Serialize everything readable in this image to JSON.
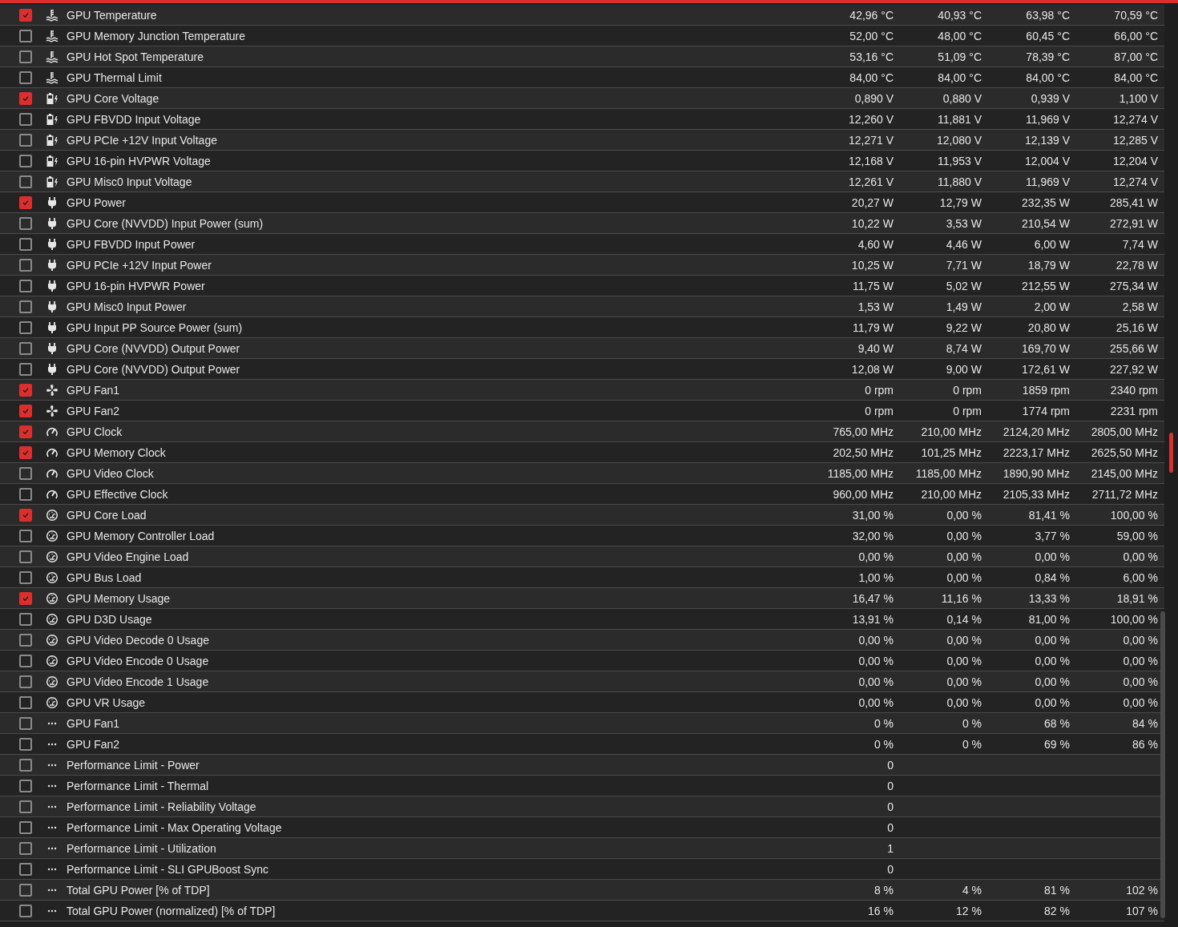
{
  "rows": [
    {
      "kind": "temperature",
      "checked": true,
      "name": "GPU Temperature",
      "values": [
        "42,96 °C",
        "40,93 °C",
        "63,98 °C",
        "70,59 °C"
      ]
    },
    {
      "kind": "temperature",
      "checked": false,
      "name": "GPU Memory Junction Temperature",
      "values": [
        "52,00 °C",
        "48,00 °C",
        "60,45 °C",
        "66,00 °C"
      ]
    },
    {
      "kind": "temperature",
      "checked": false,
      "name": "GPU Hot Spot Temperature",
      "values": [
        "53,16 °C",
        "51,09 °C",
        "78,39 °C",
        "87,00 °C"
      ]
    },
    {
      "kind": "temperature",
      "checked": false,
      "name": "GPU Thermal Limit",
      "values": [
        "84,00 °C",
        "84,00 °C",
        "84,00 °C",
        "84,00 °C"
      ]
    },
    {
      "kind": "voltage",
      "checked": true,
      "name": "GPU Core Voltage",
      "values": [
        "0,890 V",
        "0,880 V",
        "0,939 V",
        "1,100 V"
      ]
    },
    {
      "kind": "voltage",
      "checked": false,
      "name": "GPU FBVDD Input Voltage",
      "values": [
        "12,260 V",
        "11,881 V",
        "11,969 V",
        "12,274 V"
      ]
    },
    {
      "kind": "voltage",
      "checked": false,
      "name": "GPU PCIe +12V Input Voltage",
      "values": [
        "12,271 V",
        "12,080 V",
        "12,139 V",
        "12,285 V"
      ]
    },
    {
      "kind": "voltage",
      "checked": false,
      "name": "GPU 16-pin HVPWR Voltage",
      "values": [
        "12,168 V",
        "11,953 V",
        "12,004 V",
        "12,204 V"
      ]
    },
    {
      "kind": "voltage",
      "checked": false,
      "name": "GPU Misc0 Input Voltage",
      "values": [
        "12,261 V",
        "11,880 V",
        "11,969 V",
        "12,274 V"
      ]
    },
    {
      "kind": "power",
      "checked": true,
      "name": "GPU Power",
      "values": [
        "20,27 W",
        "12,79 W",
        "232,35 W",
        "285,41 W"
      ]
    },
    {
      "kind": "power",
      "checked": false,
      "name": "GPU Core (NVVDD) Input Power (sum)",
      "values": [
        "10,22 W",
        "3,53 W",
        "210,54 W",
        "272,91 W"
      ]
    },
    {
      "kind": "power",
      "checked": false,
      "name": "GPU FBVDD Input Power",
      "values": [
        "4,60 W",
        "4,46 W",
        "6,00 W",
        "7,74 W"
      ]
    },
    {
      "kind": "power",
      "checked": false,
      "name": "GPU PCIe +12V Input Power",
      "values": [
        "10,25 W",
        "7,71 W",
        "18,79 W",
        "22,78 W"
      ]
    },
    {
      "kind": "power",
      "checked": false,
      "name": "GPU 16-pin HVPWR Power",
      "values": [
        "11,75 W",
        "5,02 W",
        "212,55 W",
        "275,34 W"
      ]
    },
    {
      "kind": "power",
      "checked": false,
      "name": "GPU Misc0 Input Power",
      "values": [
        "1,53 W",
        "1,49 W",
        "2,00 W",
        "2,58 W"
      ]
    },
    {
      "kind": "power",
      "checked": false,
      "name": "GPU Input PP Source Power (sum)",
      "values": [
        "11,79 W",
        "9,22 W",
        "20,80 W",
        "25,16 W"
      ]
    },
    {
      "kind": "power",
      "checked": false,
      "name": "GPU Core (NVVDD) Output Power",
      "values": [
        "9,40 W",
        "8,74 W",
        "169,70 W",
        "255,66 W"
      ]
    },
    {
      "kind": "power",
      "checked": false,
      "name": "GPU Core (NVVDD) Output Power",
      "values": [
        "12,08 W",
        "9,00 W",
        "172,61 W",
        "227,92 W"
      ]
    },
    {
      "kind": "fan",
      "checked": true,
      "name": "GPU Fan1",
      "values": [
        "0 rpm",
        "0 rpm",
        "1859 rpm",
        "2340 rpm"
      ]
    },
    {
      "kind": "fan",
      "checked": true,
      "name": "GPU Fan2",
      "values": [
        "0 rpm",
        "0 rpm",
        "1774 rpm",
        "2231 rpm"
      ]
    },
    {
      "kind": "clock",
      "checked": true,
      "name": "GPU Clock",
      "values": [
        "765,00 MHz",
        "210,00 MHz",
        "2124,20 MHz",
        "2805,00 MHz"
      ]
    },
    {
      "kind": "clock",
      "checked": true,
      "name": "GPU Memory Clock",
      "values": [
        "202,50 MHz",
        "101,25 MHz",
        "2223,17 MHz",
        "2625,50 MHz"
      ]
    },
    {
      "kind": "clock",
      "checked": false,
      "name": "GPU Video Clock",
      "values": [
        "1185,00 MHz",
        "1185,00 MHz",
        "1890,90 MHz",
        "2145,00 MHz"
      ]
    },
    {
      "kind": "clock",
      "checked": false,
      "name": "GPU Effective Clock",
      "values": [
        "960,00 MHz",
        "210,00 MHz",
        "2105,33 MHz",
        "2711,72 MHz"
      ]
    },
    {
      "kind": "load",
      "checked": true,
      "name": "GPU Core Load",
      "values": [
        "31,00 %",
        "0,00 %",
        "81,41 %",
        "100,00 %"
      ]
    },
    {
      "kind": "load",
      "checked": false,
      "name": "GPU Memory Controller Load",
      "values": [
        "32,00 %",
        "0,00 %",
        "3,77 %",
        "59,00 %"
      ]
    },
    {
      "kind": "load",
      "checked": false,
      "name": "GPU Video Engine Load",
      "values": [
        "0,00 %",
        "0,00 %",
        "0,00 %",
        "0,00 %"
      ]
    },
    {
      "kind": "load",
      "checked": false,
      "name": "GPU Bus Load",
      "values": [
        "1,00 %",
        "0,00 %",
        "0,84 %",
        "6,00 %"
      ]
    },
    {
      "kind": "load",
      "checked": true,
      "name": "GPU Memory Usage",
      "values": [
        "16,47 %",
        "11,16 %",
        "13,33 %",
        "18,91 %"
      ]
    },
    {
      "kind": "load",
      "checked": false,
      "name": "GPU D3D Usage",
      "values": [
        "13,91 %",
        "0,14 %",
        "81,00 %",
        "100,00 %"
      ]
    },
    {
      "kind": "load",
      "checked": false,
      "name": "GPU Video Decode 0 Usage",
      "values": [
        "0,00 %",
        "0,00 %",
        "0,00 %",
        "0,00 %"
      ]
    },
    {
      "kind": "load",
      "checked": false,
      "name": "GPU Video Encode 0 Usage",
      "values": [
        "0,00 %",
        "0,00 %",
        "0,00 %",
        "0,00 %"
      ]
    },
    {
      "kind": "load",
      "checked": false,
      "name": "GPU Video Encode 1 Usage",
      "values": [
        "0,00 %",
        "0,00 %",
        "0,00 %",
        "0,00 %"
      ]
    },
    {
      "kind": "load",
      "checked": false,
      "name": "GPU VR Usage",
      "values": [
        "0,00 %",
        "0,00 %",
        "0,00 %",
        "0,00 %"
      ]
    },
    {
      "kind": "other",
      "checked": false,
      "name": "GPU Fan1",
      "values": [
        "0 %",
        "0 %",
        "68 %",
        "84 %"
      ]
    },
    {
      "kind": "other",
      "checked": false,
      "name": "GPU Fan2",
      "values": [
        "0 %",
        "0 %",
        "69 %",
        "86 %"
      ]
    },
    {
      "kind": "other",
      "checked": false,
      "name": "Performance Limit - Power",
      "values": [
        "0"
      ]
    },
    {
      "kind": "other",
      "checked": false,
      "name": "Performance Limit - Thermal",
      "values": [
        "0"
      ]
    },
    {
      "kind": "other",
      "checked": false,
      "name": "Performance Limit - Reliability Voltage",
      "values": [
        "0"
      ]
    },
    {
      "kind": "other",
      "checked": false,
      "name": "Performance Limit - Max Operating Voltage",
      "values": [
        "0"
      ]
    },
    {
      "kind": "other",
      "checked": false,
      "name": "Performance Limit - Utilization",
      "values": [
        "1"
      ]
    },
    {
      "kind": "other",
      "checked": false,
      "name": "Performance Limit - SLI GPUBoost Sync",
      "values": [
        "0"
      ]
    },
    {
      "kind": "other",
      "checked": false,
      "name": "Total GPU Power [% of TDP]",
      "values": [
        "8 %",
        "4 %",
        "81 %",
        "102 %"
      ]
    },
    {
      "kind": "other",
      "checked": false,
      "name": "Total GPU Power (normalized) [% of TDP]",
      "values": [
        "16 %",
        "12 %",
        "82 %",
        "107 %"
      ]
    }
  ]
}
